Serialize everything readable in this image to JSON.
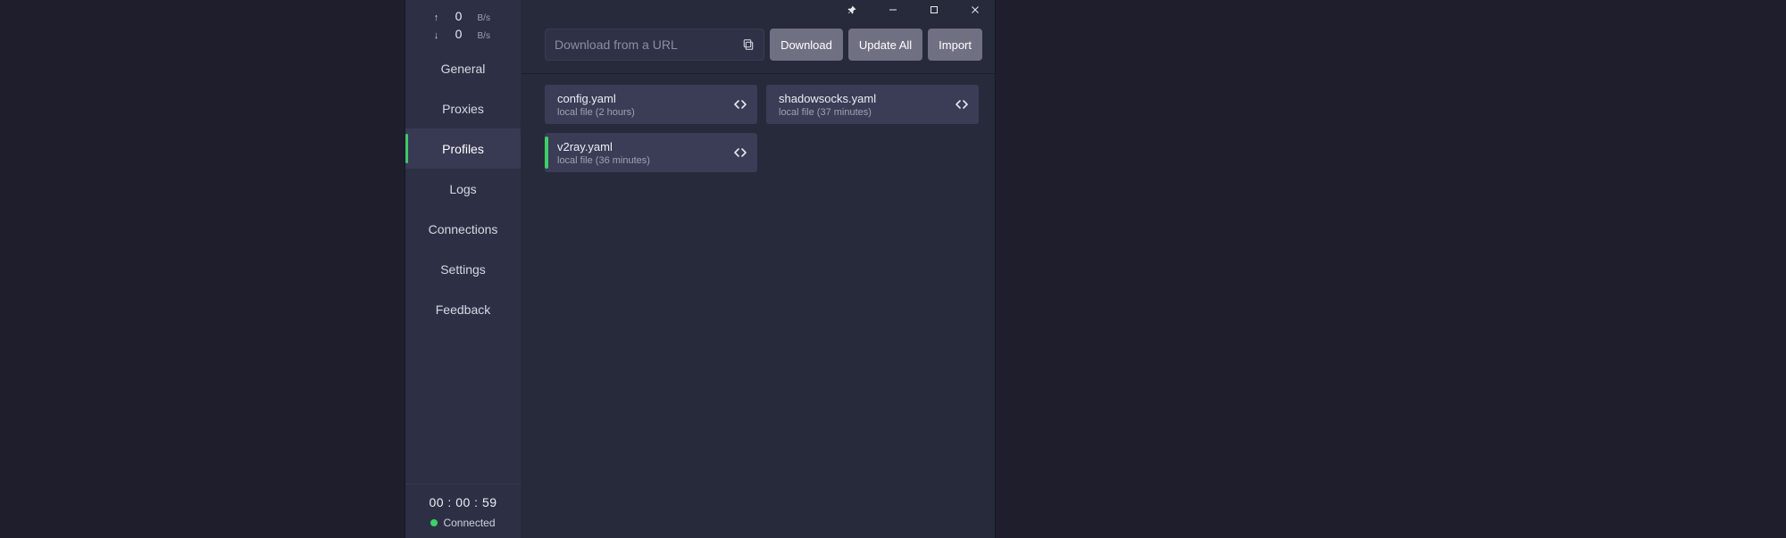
{
  "sidebar": {
    "up_arrow": "↑",
    "up_value": "0",
    "up_unit": "B/s",
    "down_arrow": "↓",
    "down_value": "0",
    "down_unit": "B/s",
    "items": [
      {
        "label": "General"
      },
      {
        "label": "Proxies"
      },
      {
        "label": "Profiles"
      },
      {
        "label": "Logs"
      },
      {
        "label": "Connections"
      },
      {
        "label": "Settings"
      },
      {
        "label": "Feedback"
      }
    ],
    "active_index": 2,
    "timer": "00 : 00 : 59",
    "status_text": "Connected"
  },
  "toolbar": {
    "url_placeholder": "Download from a URL",
    "download_label": "Download",
    "update_all_label": "Update All",
    "import_label": "Import"
  },
  "profiles": [
    {
      "name": "config.yaml",
      "source": "local file (2 hours)",
      "active": false
    },
    {
      "name": "shadowsocks.yaml",
      "source": "local file (37 minutes)",
      "active": false
    },
    {
      "name": "v2ray.yaml",
      "source": "local file (36 minutes)",
      "active": true
    }
  ]
}
